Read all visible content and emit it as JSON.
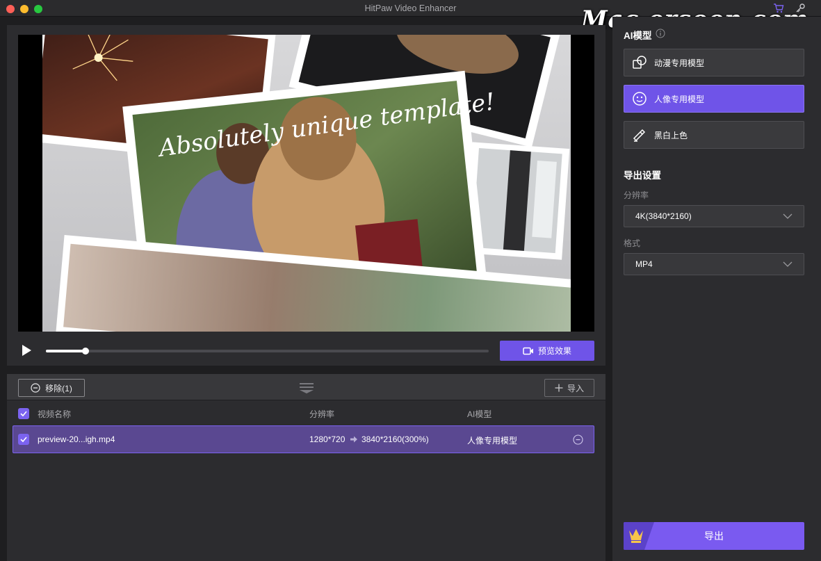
{
  "window": {
    "title": "HitPaw Video Enhancer",
    "watermark": "Mac.orsoon.com"
  },
  "titlebar_icons": [
    "cart-icon",
    "key-icon"
  ],
  "preview": {
    "overlay_text": "Absolutely unique template!",
    "progress_fraction": 0.09,
    "preview_button_label": "预览效果"
  },
  "toolbar": {
    "remove_label": "移除(1)",
    "import_label": "导入"
  },
  "table": {
    "headers": {
      "name": "视频名称",
      "resolution": "分辨率",
      "model": "AI模型"
    },
    "rows": [
      {
        "name": "preview-20...igh.mp4",
        "source_res": "1280*720",
        "target_res": "3840*2160(300%)",
        "model": "人像专用模型",
        "checked": true
      }
    ]
  },
  "sidebar": {
    "ai_model_title": "AI模型",
    "models": [
      {
        "label": "动漫专用模型",
        "icon": "anime-model-icon",
        "active": false
      },
      {
        "label": "人像专用模型",
        "icon": "portrait-model-icon",
        "active": true
      },
      {
        "label": "黑白上色",
        "icon": "colorize-icon",
        "active": false
      }
    ],
    "export_settings_title": "导出设置",
    "resolution_label": "分辨率",
    "resolution_value": "4K(3840*2160)",
    "format_label": "格式",
    "format_value": "MP4",
    "export_label": "导出"
  },
  "colors": {
    "accent": "#6f54e8",
    "row_selected": "#5a4891",
    "panel": "#2c2c2f"
  }
}
